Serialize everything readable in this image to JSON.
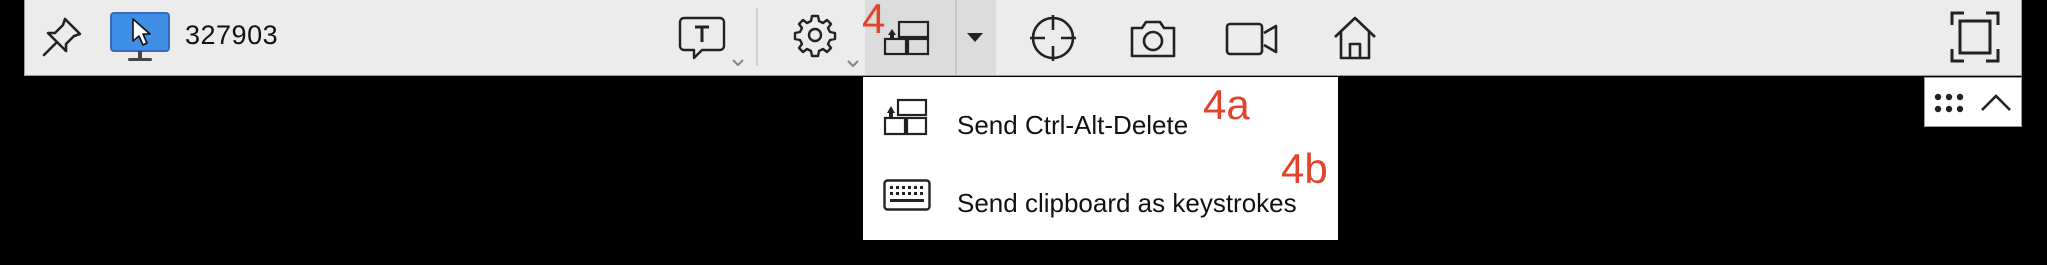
{
  "toolbar": {
    "session_id": "327903",
    "icons": {
      "pin": "pin-icon",
      "monitor": "monitor-icon",
      "chat": "chat-icon",
      "settings": "gear-icon",
      "keys": "send-keys-icon",
      "dropdown": "caret-down-icon",
      "crosshair": "crosshair-icon",
      "camera": "camera-icon",
      "video": "video-icon",
      "home": "home-icon",
      "fullscreen": "fullscreen-icon"
    },
    "monitor_accent": "#3e8ee6"
  },
  "menu": {
    "items": [
      {
        "label": "Send Ctrl-Alt-Delete",
        "icon": "ctrl-alt-del-icon"
      },
      {
        "label": "Send clipboard as keystrokes",
        "icon": "keyboard-icon"
      }
    ]
  },
  "annotations": {
    "keys": "4",
    "ctrl_alt_del": "4a",
    "clipboard": "4b",
    "color": "#e0452c"
  },
  "expander": {
    "icons": [
      "grid-dots-icon",
      "chevron-up-icon"
    ]
  }
}
